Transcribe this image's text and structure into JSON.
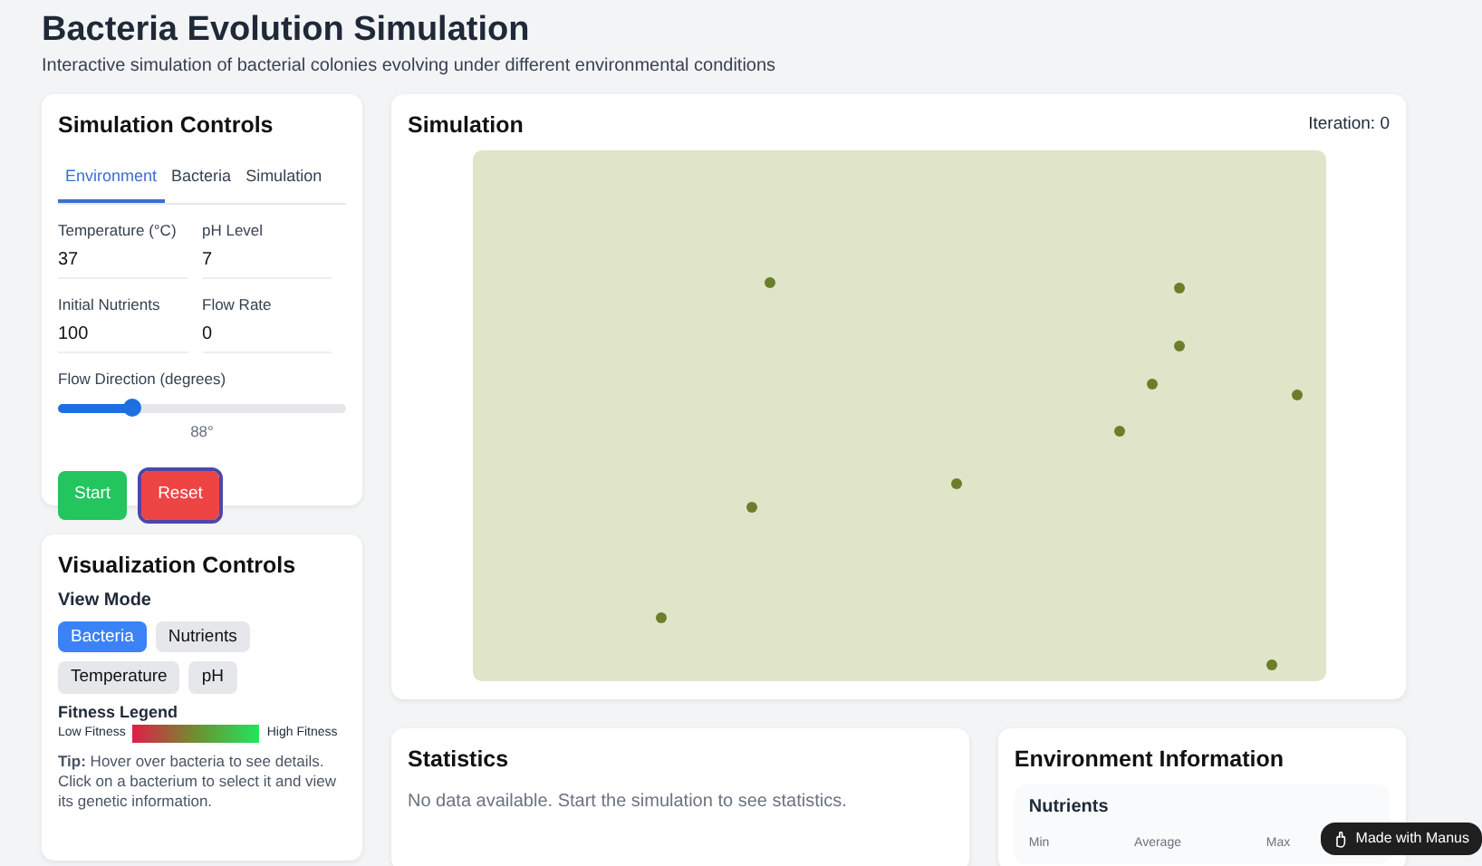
{
  "header": {
    "title": "Bacteria Evolution Simulation",
    "subtitle": "Interactive simulation of bacterial colonies evolving under different environmental conditions"
  },
  "simulation_controls": {
    "title": "Simulation Controls",
    "tabs": [
      {
        "label": "Environment",
        "selected": true
      },
      {
        "label": "Bacteria",
        "selected": false
      },
      {
        "label": "Simulation",
        "selected": false
      }
    ],
    "fields": [
      {
        "label": "Temperature (°C)",
        "value": "37"
      },
      {
        "label": "pH Level",
        "value": "7"
      },
      {
        "label": "Initial Nutrients",
        "value": "100"
      },
      {
        "label": "Flow Rate",
        "value": "0"
      }
    ],
    "flow_direction": {
      "label": "Flow Direction (degrees)",
      "level": 0.26,
      "reading": "88°"
    },
    "buttons": [
      {
        "label": "Start",
        "kind": "start"
      },
      {
        "label": "Reset",
        "kind": "reset"
      }
    ]
  },
  "visualization_controls": {
    "title": "Visualization Controls",
    "view_mode_label": "View Mode",
    "view_modes": [
      {
        "label": "Bacteria",
        "selected": true
      },
      {
        "label": "Nutrients",
        "selected": false
      },
      {
        "label": "Temperature",
        "selected": false
      },
      {
        "label": "pH",
        "selected": false
      }
    ],
    "legend": {
      "title": "Fitness Legend",
      "low": "Low Fitness",
      "high": "High Fitness"
    },
    "tip": "**Tip:** Hover over bacteria to see details. Click on a bacterium to select it and view its genetic information."
  },
  "simulation": {
    "title": "Simulation",
    "iteration": "Iteration: 0"
  },
  "statistics": {
    "title": "Statistics",
    "message": "No data available. Start the simulation to see statistics."
  },
  "environment_information": {
    "title": "Environment Information",
    "section": "Nutrients",
    "columns": [
      "Min",
      "Average",
      "Max"
    ]
  },
  "badge": {
    "label": "Made with Manus"
  }
}
